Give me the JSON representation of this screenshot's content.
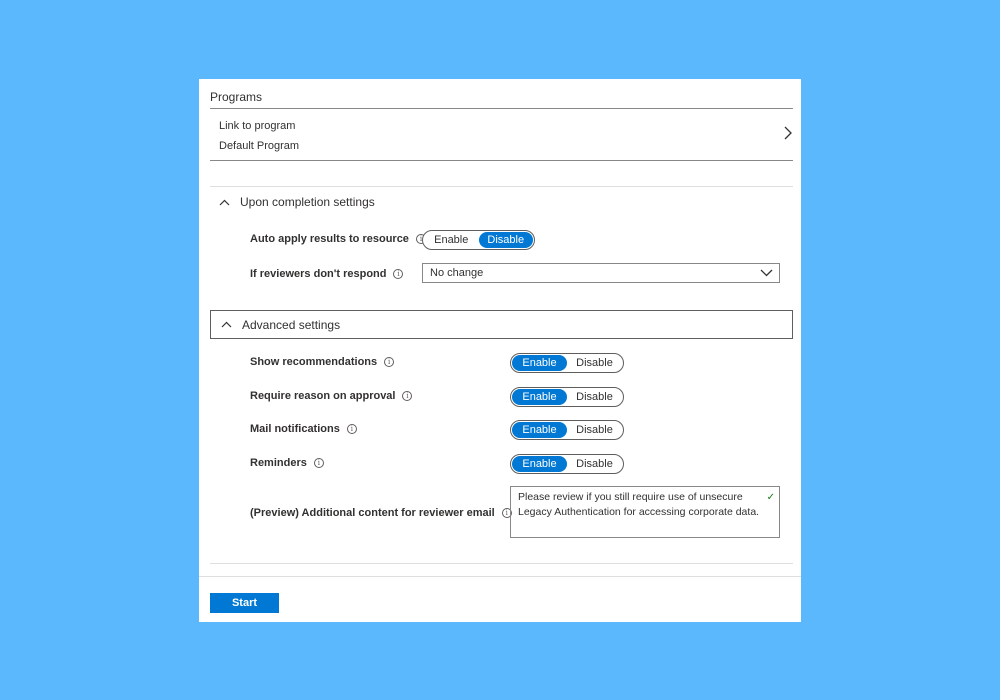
{
  "programs": {
    "title": "Programs",
    "link_label": "Link to program",
    "link_value": "Default Program"
  },
  "completion": {
    "header": "Upon completion settings",
    "auto_apply": {
      "label": "Auto apply results to resource",
      "enable": "Enable",
      "disable": "Disable",
      "selected": "Disable"
    },
    "no_response": {
      "label": "If reviewers don't respond",
      "value": "No change"
    }
  },
  "advanced": {
    "header": "Advanced settings",
    "rows": [
      {
        "label": "Show recommendations",
        "enable": "Enable",
        "disable": "Disable",
        "selected": "Enable"
      },
      {
        "label": "Require reason on approval",
        "enable": "Enable",
        "disable": "Disable",
        "selected": "Enable"
      },
      {
        "label": "Mail notifications",
        "enable": "Enable",
        "disable": "Disable",
        "selected": "Enable"
      },
      {
        "label": "Reminders",
        "enable": "Enable",
        "disable": "Disable",
        "selected": "Enable"
      }
    ],
    "additional": {
      "label": "(Preview) Additional content for reviewer email",
      "value": "Please review if you still require use of unsecure Legacy Authentication for accessing corporate data."
    }
  },
  "footer": {
    "start_label": "Start"
  },
  "colors": {
    "background": "#5cb8fd",
    "accent": "#0078d4",
    "valid_check": "#107c10"
  },
  "icons": [
    "chevron-right-icon",
    "chevron-up-icon",
    "chevron-down-icon",
    "info-icon",
    "checkmark-icon"
  ]
}
